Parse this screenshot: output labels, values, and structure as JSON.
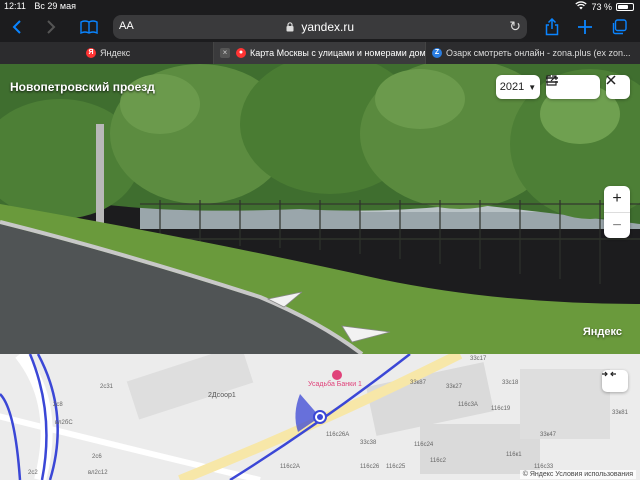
{
  "status": {
    "time": "12:11",
    "date": "Вс 29 мая",
    "battery": "73 %",
    "battery_level": 0.73
  },
  "browser": {
    "aa_label": "AA",
    "url": "yandex.ru",
    "tabs": [
      {
        "label": "Яндекс",
        "favicon": "yandex-favicon",
        "active": false
      },
      {
        "label": "Карта Москвы с улицами и номерами дом...",
        "favicon": "maps-pin-favicon",
        "active": true
      },
      {
        "label": "Озарк смотреть онлайн - zona.plus (ex zon...",
        "favicon": "zona-favicon",
        "active": false
      }
    ]
  },
  "panorama": {
    "street_name": "Новопетровский проезд",
    "year": "2021",
    "watermark": "Яндекс"
  },
  "minimap": {
    "poi": "Усадьба Банки 1",
    "street": "2Дсоор1",
    "attribution": "© Яндекс  Условия использования",
    "labels": [
      "2с31",
      "2с8",
      "вл2бС",
      "2с6",
      "вл2с12",
      "2с2",
      "33к87",
      "33к27",
      "33с17",
      "33с18",
      "116с3А",
      "116с19",
      "116с26А",
      "33с38",
      "116с24",
      "116с26",
      "116с25",
      "116с2",
      "116к1",
      "33к47",
      "116с33",
      "116с2А",
      "33к81"
    ]
  },
  "colors": {
    "accent": "#0a84ff",
    "route": "#3b47d6",
    "poi": "#e0427a"
  }
}
